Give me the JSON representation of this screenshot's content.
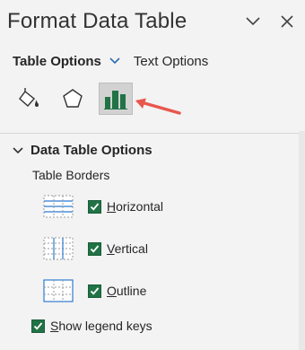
{
  "pane": {
    "title": "Format Data Table",
    "tabs": {
      "active": "Table Options",
      "other": "Text Options"
    },
    "icons": [
      "fill-line-icon",
      "effects-icon",
      "size-properties-icon"
    ],
    "section": {
      "title": "Data Table Options",
      "sublabel": "Table Borders",
      "options": [
        {
          "label_first": "H",
          "label_rest": "orizontal",
          "checked": true
        },
        {
          "label_first": "V",
          "label_rest": "ertical",
          "checked": true
        },
        {
          "label_first": "O",
          "label_rest": "utline",
          "checked": true
        }
      ],
      "legend": {
        "label_first": "S",
        "label_rest": "how legend keys",
        "checked": true
      }
    }
  },
  "colors": {
    "accent": "#217346",
    "arrow": "#e8574e",
    "tab_chevron": "#2b6cb3"
  }
}
